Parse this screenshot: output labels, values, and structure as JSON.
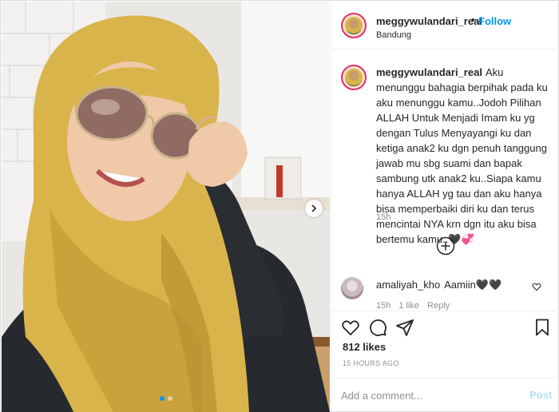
{
  "post": {
    "username": "meggywulandari_real",
    "follow_label": "Follow",
    "bullet": "•",
    "location": "Bandung"
  },
  "caption": {
    "username": "meggywulandari_real",
    "text": "Aku menunggu bahagia berpihak pada ku aku menunggu kamu..Jodoh Pilihan ALLAH Untuk Menjadi Imam ku yg dengan Tulus Menyayangi ku dan ketiga anak2 ku dgn penuh tanggung jawab mu sbg suami dan bapak sambung utk anak2 ku..Siapa kamu hanya ALLAH yg tau dan aku hanya bisa memperbaiki diri ku dan terus mencintai NYA krn dgn itu aku bisa bertemu kamu..🖤💞",
    "time": "15h"
  },
  "reply": {
    "username": "amaliyah_kho",
    "text": "Aamiin🖤🖤",
    "time": "15h",
    "likes": "1 like",
    "reply_label": "Reply"
  },
  "likes_label": "812 likes",
  "posted_ago": "15 HOURS AGO",
  "comment_input": {
    "placeholder": "Add a comment..."
  },
  "post_button": "Post",
  "carousel": {
    "slides": 2,
    "active": 1
  },
  "colors": {
    "accent": "#0095f6",
    "muted": "#8e8e8e",
    "post_disabled": "#b2dffc",
    "hijab": "#d9b44a"
  }
}
